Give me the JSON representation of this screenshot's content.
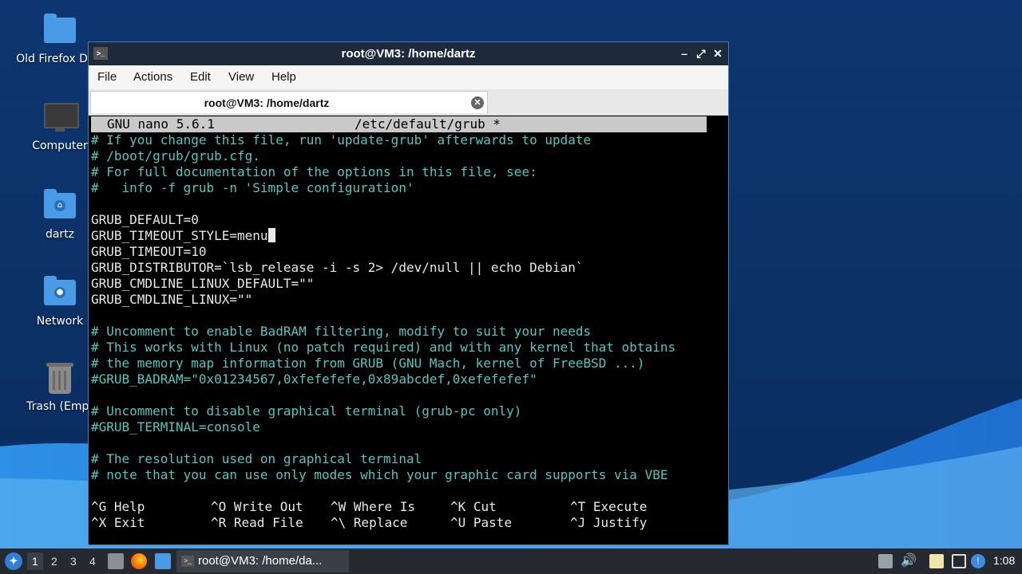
{
  "desktop": {
    "icons": [
      {
        "label": "Old Firefox D",
        "icon": "folder-icon"
      },
      {
        "label": "Computer",
        "icon": "computer-icon"
      },
      {
        "label": "dartz",
        "icon": "home-folder-icon"
      },
      {
        "label": "Network",
        "icon": "network-folder-icon"
      },
      {
        "label": "Trash (Empt",
        "icon": "trash-icon"
      }
    ]
  },
  "window": {
    "title": "root@VM3: /home/dartz",
    "controls": {
      "minimize": "–",
      "maximize": "⤢",
      "close": "✕"
    },
    "menu": [
      "File",
      "Actions",
      "Edit",
      "View",
      "Help"
    ],
    "tab": {
      "label": "root@VM3: /home/dartz",
      "close": "✕"
    }
  },
  "nano": {
    "version": "GNU nano 5.6.1",
    "file": "/etc/default/grub *",
    "lines": [
      {
        "text": "# If you change this file, run 'update-grub' afterwards to update",
        "comment": true
      },
      {
        "text": "# /boot/grub/grub.cfg.",
        "comment": true
      },
      {
        "text": "# For full documentation of the options in this file, see:",
        "comment": true
      },
      {
        "text": "#   info -f grub -n 'Simple configuration'",
        "comment": true
      },
      {
        "text": "",
        "comment": false
      },
      {
        "text": "GRUB_DEFAULT=0",
        "comment": false
      },
      {
        "text": "GRUB_TIMEOUT_STYLE=menu",
        "comment": false,
        "cursor": true
      },
      {
        "text": "GRUB_TIMEOUT=10",
        "comment": false
      },
      {
        "text": "GRUB_DISTRIBUTOR=`lsb_release -i -s 2> /dev/null || echo Debian`",
        "comment": false
      },
      {
        "text": "GRUB_CMDLINE_LINUX_DEFAULT=\"\"",
        "comment": false
      },
      {
        "text": "GRUB_CMDLINE_LINUX=\"\"",
        "comment": false
      },
      {
        "text": "",
        "comment": false
      },
      {
        "text": "# Uncomment to enable BadRAM filtering, modify to suit your needs",
        "comment": true
      },
      {
        "text": "# This works with Linux (no patch required) and with any kernel that obtains",
        "comment": true
      },
      {
        "text": "# the memory map information from GRUB (GNU Mach, kernel of FreeBSD ...)",
        "comment": true
      },
      {
        "text": "#GRUB_BADRAM=\"0x01234567,0xfefefefe,0x89abcdef,0xefefefef\"",
        "comment": true
      },
      {
        "text": "",
        "comment": false
      },
      {
        "text": "# Uncomment to disable graphical terminal (grub-pc only)",
        "comment": true
      },
      {
        "text": "#GRUB_TERMINAL=console",
        "comment": true
      },
      {
        "text": "",
        "comment": false
      },
      {
        "text": "# The resolution used on graphical terminal",
        "comment": true
      },
      {
        "text": "# note that you can use only modes which your graphic card supports via VBE",
        "comment": true
      }
    ],
    "shortcuts": [
      [
        {
          "key": "^G",
          "label": "Help"
        },
        {
          "key": "^O",
          "label": "Write Out"
        },
        {
          "key": "^W",
          "label": "Where Is"
        },
        {
          "key": "^K",
          "label": "Cut"
        },
        {
          "key": "^T",
          "label": "Execute"
        }
      ],
      [
        {
          "key": "^X",
          "label": "Exit"
        },
        {
          "key": "^R",
          "label": "Read File"
        },
        {
          "key": "^\\",
          "label": "Replace"
        },
        {
          "key": "^U",
          "label": "Paste"
        },
        {
          "key": "^J",
          "label": "Justify"
        }
      ]
    ]
  },
  "taskbar": {
    "workspaces": [
      "1",
      "2",
      "3",
      "4"
    ],
    "active_workspace": "1",
    "task_label": "root@VM3: /home/da...",
    "clock": "1:08"
  }
}
